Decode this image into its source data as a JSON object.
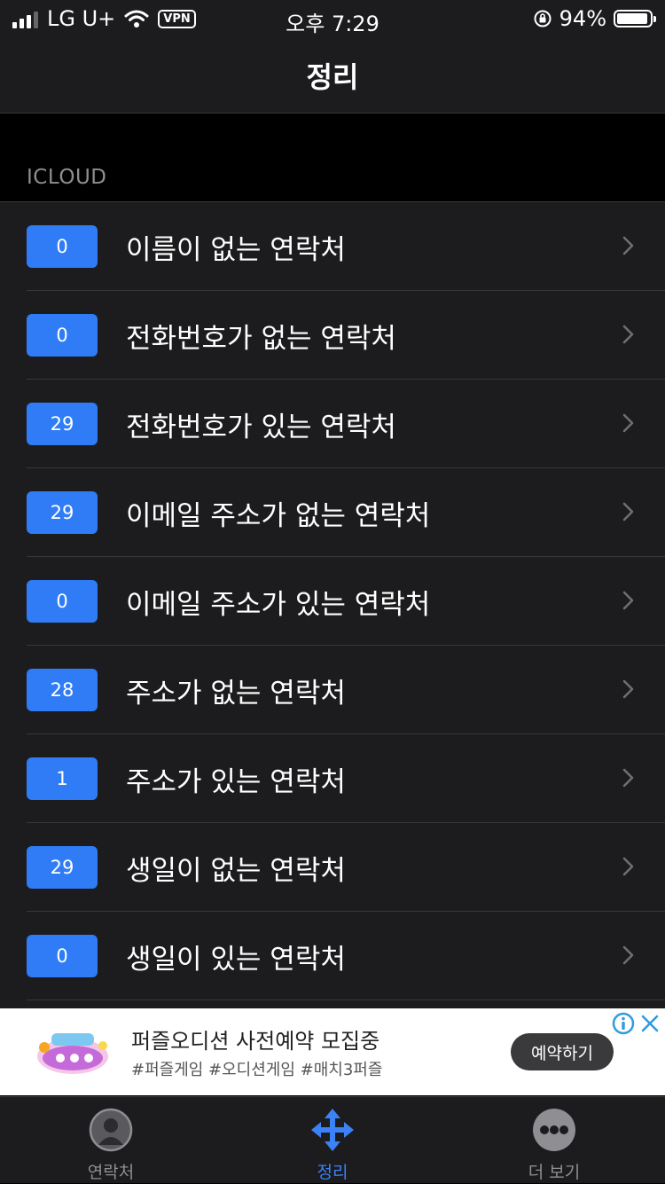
{
  "status_bar": {
    "carrier": "LG U+",
    "vpn": "VPN",
    "time": "오후 7:29",
    "battery": "94%",
    "battery_level": 0.94
  },
  "nav": {
    "title": "정리"
  },
  "section": {
    "header": "ICLOUD"
  },
  "rows": [
    {
      "count": "0",
      "label": "이름이 없는 연락처"
    },
    {
      "count": "0",
      "label": "전화번호가 없는 연락처"
    },
    {
      "count": "29",
      "label": "전화번호가 있는 연락처"
    },
    {
      "count": "29",
      "label": "이메일 주소가 없는 연락처"
    },
    {
      "count": "0",
      "label": "이메일 주소가 있는 연락처"
    },
    {
      "count": "28",
      "label": "주소가 없는 연락처"
    },
    {
      "count": "1",
      "label": "주소가 있는 연락처"
    },
    {
      "count": "29",
      "label": "생일이 없는 연락처"
    },
    {
      "count": "0",
      "label": "생일이 있는 연락처"
    }
  ],
  "ad": {
    "title": "퍼즐오디션 사전예약 모집중",
    "tags": "#퍼즐게임 #오디션게임 #매치3퍼즐",
    "button": "예약하기"
  },
  "tabs": [
    {
      "label": "연락처",
      "icon": "contacts-icon"
    },
    {
      "label": "정리",
      "icon": "move-arrows-icon",
      "active": true
    },
    {
      "label": "더 보기",
      "icon": "more-icon"
    }
  ],
  "colors": {
    "accent": "#3b82f6",
    "badge": "#2f7cf6",
    "background": "#1c1c1e"
  }
}
